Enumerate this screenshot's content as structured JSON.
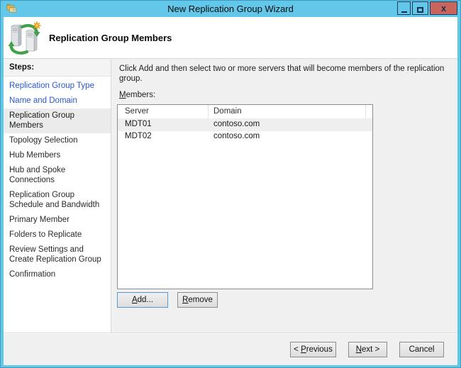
{
  "window": {
    "title": "New Replication Group Wizard",
    "controls": {
      "minimize": "minimize-icon",
      "maximize": "maximize-icon",
      "close": "close-icon",
      "close_glyph": "x"
    }
  },
  "header": {
    "title": "Replication Group Members",
    "icon": "replication-group-icon"
  },
  "sidebar": {
    "heading": "Steps:",
    "items": [
      {
        "label": "Replication Group Type",
        "state": "visited"
      },
      {
        "label": "Name and Domain",
        "state": "visited"
      },
      {
        "label": "Replication Group Members",
        "state": "current"
      },
      {
        "label": "Topology Selection",
        "state": "upcoming"
      },
      {
        "label": "Hub Members",
        "state": "upcoming"
      },
      {
        "label": "Hub and Spoke Connections",
        "state": "upcoming"
      },
      {
        "label": "Replication Group Schedule and Bandwidth",
        "state": "upcoming"
      },
      {
        "label": "Primary Member",
        "state": "upcoming"
      },
      {
        "label": "Folders to Replicate",
        "state": "upcoming"
      },
      {
        "label": "Review Settings and Create Replication Group",
        "state": "upcoming"
      },
      {
        "label": "Confirmation",
        "state": "upcoming"
      }
    ]
  },
  "main": {
    "instruction": "Click Add and then select two or more servers that will become members of the replication group.",
    "members_label": {
      "text": "Members:",
      "mnemonic": "M"
    },
    "table": {
      "columns": [
        "Server",
        "Domain"
      ],
      "rows": [
        {
          "server": "MDT01",
          "domain": "contoso.com",
          "selected": true
        },
        {
          "server": "MDT02",
          "domain": "contoso.com",
          "selected": false
        }
      ]
    },
    "add_button": {
      "label": "Add...",
      "mnemonic": "A"
    },
    "remove_button": {
      "label": "Remove",
      "mnemonic": "R"
    }
  },
  "footer": {
    "previous_button": {
      "label": "< Previous",
      "mnemonic": "P"
    },
    "next_button": {
      "label": "Next >",
      "mnemonic": "N"
    },
    "cancel_button": {
      "label": "Cancel"
    }
  },
  "colors": {
    "titlebar_blue": "#63c7e9",
    "close_button_red": "#c8655c",
    "visited_link_blue": "#2b57ce",
    "content_bg": "#f0f0f0",
    "selected_row": "#efefef",
    "focus_border_blue": "#5598d7",
    "arrow_green": "#3fa14a",
    "star_orange": "#f5a623"
  }
}
